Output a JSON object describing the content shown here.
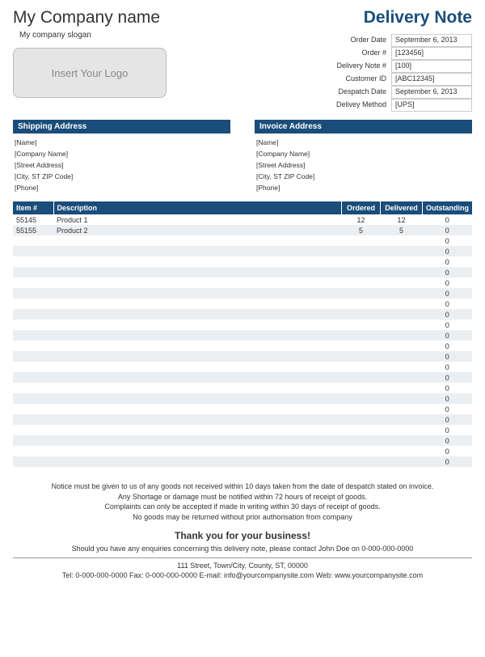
{
  "company": {
    "name": "My Company name",
    "slogan": "My company slogan",
    "logo_placeholder": "Insert Your Logo"
  },
  "doc_title": "Delivery Note",
  "order_meta": {
    "rows": [
      {
        "label": "Order Date",
        "value": "September 6, 2013"
      },
      {
        "label": "Order #",
        "value": "[123456]"
      },
      {
        "label": "Delivery Note #",
        "value": "[100]"
      },
      {
        "label": "Customer ID",
        "value": "[ABC12345]"
      },
      {
        "label": "Despatch Date",
        "value": "September 6, 2013"
      },
      {
        "label": "Delivey Method",
        "value": "[UPS]"
      }
    ]
  },
  "shipping": {
    "header": "Shipping Address",
    "lines": [
      "[Name]",
      "[Company Name]",
      "[Street Address]",
      "[City, ST  ZIP Code]",
      "[Phone]"
    ]
  },
  "invoice": {
    "header": "Invoice Address",
    "lines": [
      "[Name]",
      "[Company Name]",
      "[Street Address]",
      "[City, ST  ZIP Code]",
      "[Phone]"
    ]
  },
  "items": {
    "headers": {
      "item": "Item #",
      "desc": "Description",
      "ordered": "Ordered",
      "delivered": "Delivered",
      "outstanding": "Outstanding"
    },
    "rows": [
      {
        "item": "55145",
        "desc": "Product 1",
        "ordered": "12",
        "delivered": "12",
        "outstanding": "0"
      },
      {
        "item": "55155",
        "desc": "Product 2",
        "ordered": "5",
        "delivered": "5",
        "outstanding": "0"
      },
      {
        "item": "",
        "desc": "",
        "ordered": "",
        "delivered": "",
        "outstanding": "0"
      },
      {
        "item": "",
        "desc": "",
        "ordered": "",
        "delivered": "",
        "outstanding": "0"
      },
      {
        "item": "",
        "desc": "",
        "ordered": "",
        "delivered": "",
        "outstanding": "0"
      },
      {
        "item": "",
        "desc": "",
        "ordered": "",
        "delivered": "",
        "outstanding": "0"
      },
      {
        "item": "",
        "desc": "",
        "ordered": "",
        "delivered": "",
        "outstanding": "0"
      },
      {
        "item": "",
        "desc": "",
        "ordered": "",
        "delivered": "",
        "outstanding": "0"
      },
      {
        "item": "",
        "desc": "",
        "ordered": "",
        "delivered": "",
        "outstanding": "0"
      },
      {
        "item": "",
        "desc": "",
        "ordered": "",
        "delivered": "",
        "outstanding": "0"
      },
      {
        "item": "",
        "desc": "",
        "ordered": "",
        "delivered": "",
        "outstanding": "0"
      },
      {
        "item": "",
        "desc": "",
        "ordered": "",
        "delivered": "",
        "outstanding": "0"
      },
      {
        "item": "",
        "desc": "",
        "ordered": "",
        "delivered": "",
        "outstanding": "0"
      },
      {
        "item": "",
        "desc": "",
        "ordered": "",
        "delivered": "",
        "outstanding": "0"
      },
      {
        "item": "",
        "desc": "",
        "ordered": "",
        "delivered": "",
        "outstanding": "0"
      },
      {
        "item": "",
        "desc": "",
        "ordered": "",
        "delivered": "",
        "outstanding": "0"
      },
      {
        "item": "",
        "desc": "",
        "ordered": "",
        "delivered": "",
        "outstanding": "0"
      },
      {
        "item": "",
        "desc": "",
        "ordered": "",
        "delivered": "",
        "outstanding": "0"
      },
      {
        "item": "",
        "desc": "",
        "ordered": "",
        "delivered": "",
        "outstanding": "0"
      },
      {
        "item": "",
        "desc": "",
        "ordered": "",
        "delivered": "",
        "outstanding": "0"
      },
      {
        "item": "",
        "desc": "",
        "ordered": "",
        "delivered": "",
        "outstanding": "0"
      },
      {
        "item": "",
        "desc": "",
        "ordered": "",
        "delivered": "",
        "outstanding": "0"
      },
      {
        "item": "",
        "desc": "",
        "ordered": "",
        "delivered": "",
        "outstanding": "0"
      },
      {
        "item": "",
        "desc": "",
        "ordered": "",
        "delivered": "",
        "outstanding": "0"
      }
    ]
  },
  "notice": {
    "l1": "Notice must be given to us of any goods not received within 10 days taken from the date of despatch stated on invoice.",
    "l2": "Any Shortage or damage must be notified within 72 hours of receipt of goods.",
    "l3": "Complaints can only be accepted if made in writing within 30 days of receipt of goods.",
    "l4": "No goods may be returned without prior authorisation from company"
  },
  "thanks": "Thank you for your business!",
  "enquiry": "Should you have any enquiries concerning this delivery note, please contact John Doe on 0-000-000-0000",
  "footer": {
    "addr": "111 Street, Town/City, County, ST, 00000",
    "contact": "Tel: 0-000-000-0000 Fax: 0-000-000-0000 E-mail: info@yourcompanysite.com Web: www.yourcompanysite.com"
  }
}
